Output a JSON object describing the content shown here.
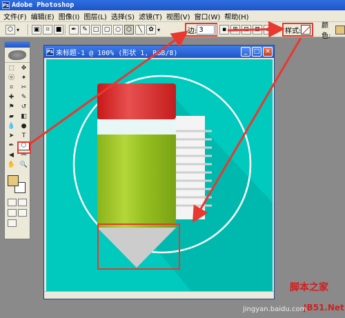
{
  "window": {
    "app_title": "Adobe Photoshop",
    "app_icon_text": "Ps"
  },
  "menu": [
    "文件(F)",
    "编辑(E)",
    "图像(I)",
    "图层(L)",
    "选择(S)",
    "滤镜(T)",
    "视图(V)",
    "窗口(W)",
    "帮助(H)"
  ],
  "options_bar": {
    "sides_label": "边:",
    "sides_value": "3",
    "style_label": "样式:",
    "color_label": "颜色:",
    "color_hex": "#e8c27a"
  },
  "toolbox": {
    "foreground_color": "#e8c87a",
    "background_color": "#ffffff"
  },
  "document": {
    "title": "未标题-1 @ 100% (形状 1, RGB/8)",
    "icon_text": "Ps",
    "canvas_bg": "#00c9bd",
    "pencil_colors": {
      "eraser": "#e02020",
      "ferrule": "#e8f7f5",
      "body": "#9bc11f",
      "tip": "#cccccc"
    },
    "paper_color": "#f4f4f4"
  },
  "watermarks": {
    "jb51": "脚本之家",
    "jb51_url": "JB51.Net",
    "jingyan": "jingyan.baidu.com"
  },
  "colors": {
    "annotation": "#e8382f",
    "xp_blue": "#2a63d6"
  }
}
